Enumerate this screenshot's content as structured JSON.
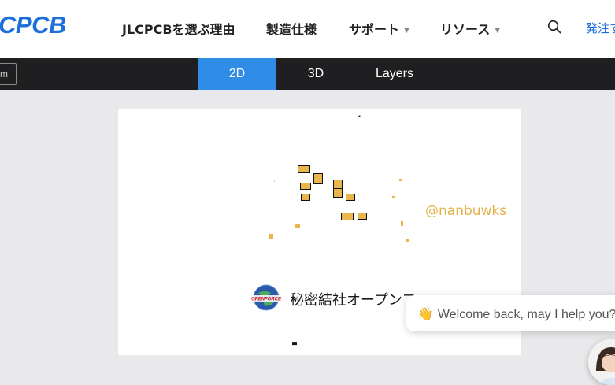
{
  "header": {
    "logo": "CPCB",
    "nav": [
      {
        "label": "JLCPCBを選ぶ理由",
        "dropdown": false
      },
      {
        "label": "製造仕様",
        "dropdown": false
      },
      {
        "label": "サポート",
        "dropdown": true
      },
      {
        "label": "リソース",
        "dropdown": true
      }
    ],
    "order_link": "発注す",
    "search_icon": "search-icon"
  },
  "viewbar": {
    "unit": "m",
    "tabs": [
      {
        "label": "2D",
        "active": true
      },
      {
        "label": "3D",
        "active": false
      },
      {
        "label": "Layers",
        "active": false
      }
    ]
  },
  "canvas": {
    "watermark": "@nanbuwks",
    "silkscreen_text": "秘密結社オープンフ",
    "logo_badge_text": "OPENFORCE",
    "pad_color": "#e7b64c"
  },
  "chat": {
    "message": "Welcome back, may I help you?",
    "emoji": "👋"
  },
  "colors": {
    "brand": "#1d6fdc",
    "tab_active": "#2f8de8",
    "viewbar_bg": "#1f1f21"
  }
}
